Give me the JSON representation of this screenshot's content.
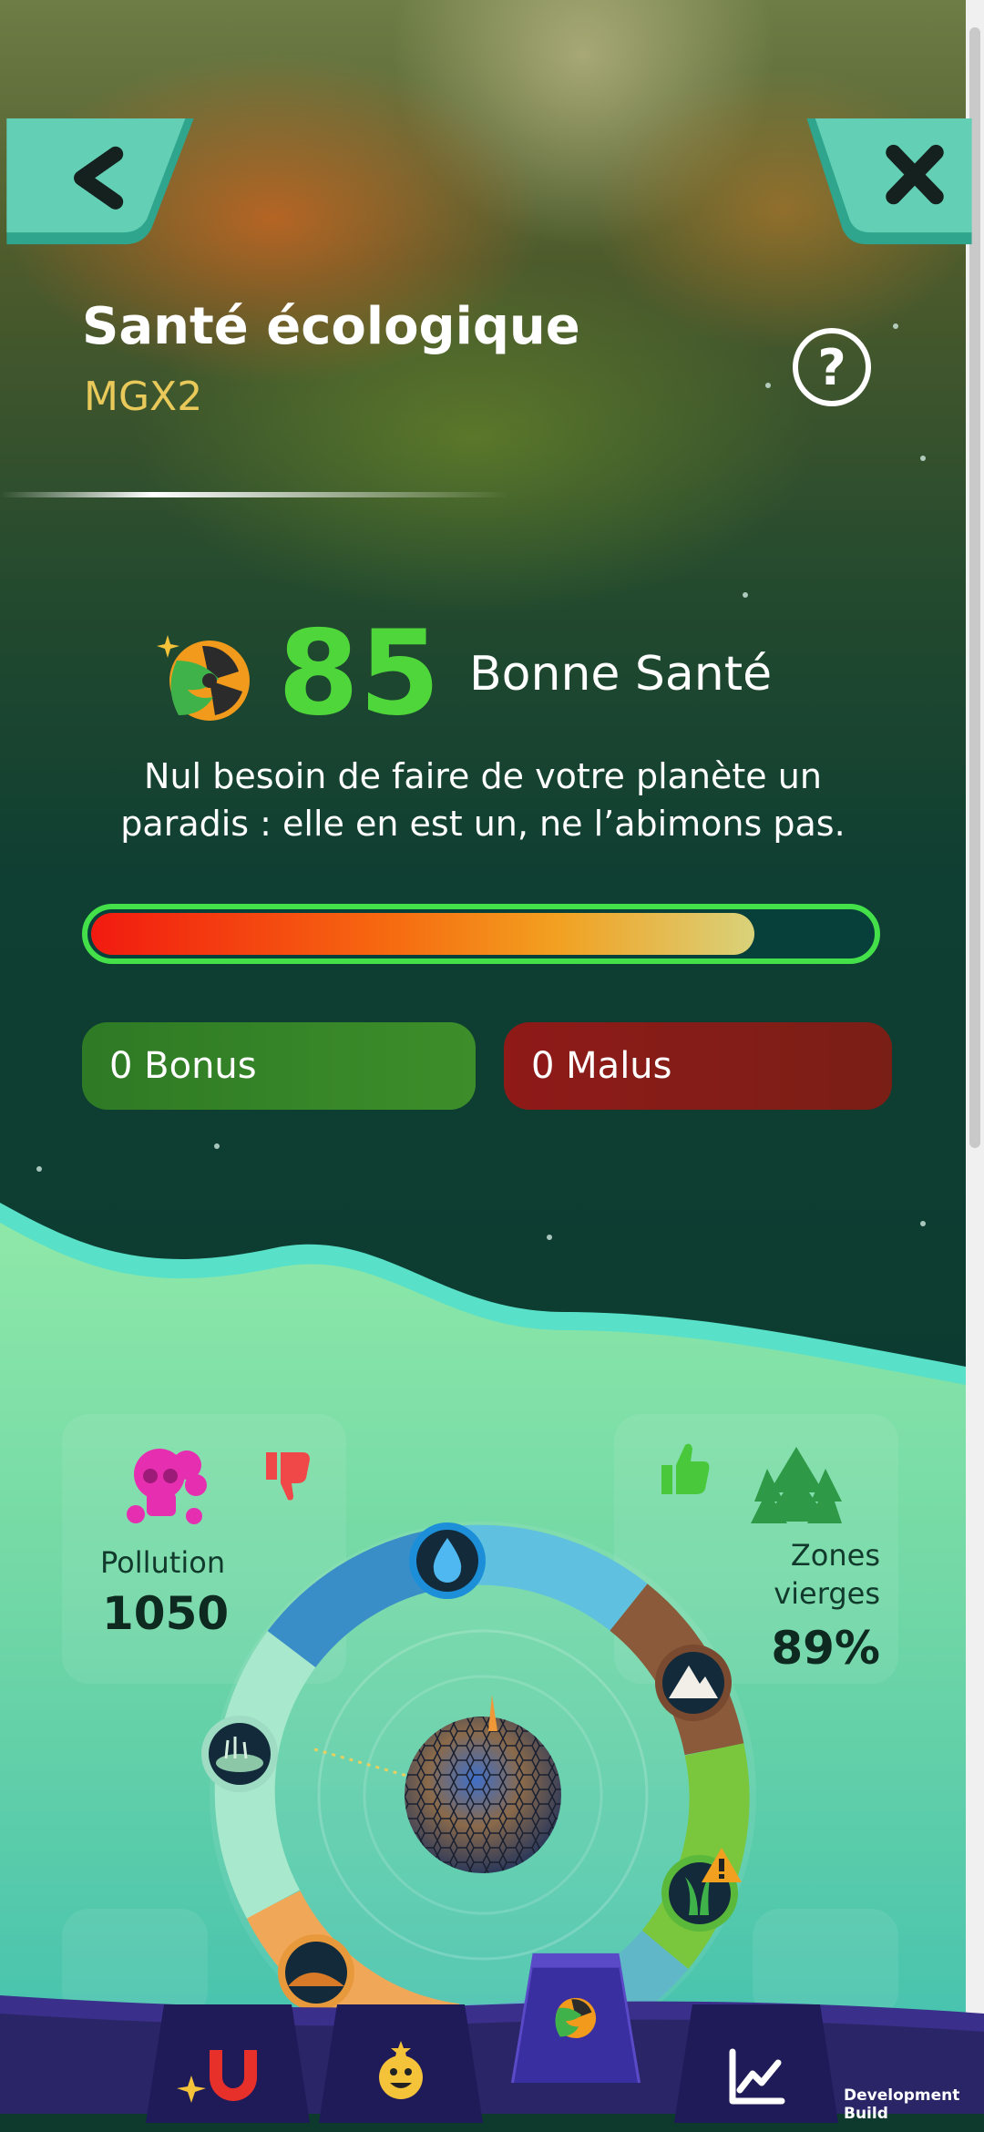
{
  "header": {
    "title": "Santé écologique",
    "subtitle": "MGX2"
  },
  "score": {
    "value": "85",
    "label": "Bonne Santé",
    "description": "Nul besoin de faire de votre planète un paradis : elle en est un, ne l’abimons pas.",
    "health_fraction": 0.85
  },
  "bonus": {
    "label": "0 Bonus"
  },
  "malus": {
    "label": "0 Malus"
  },
  "stats": {
    "pollution": {
      "label": "Pollution",
      "value": "1050"
    },
    "zones": {
      "label": "Zones vierges",
      "value": "89%"
    }
  },
  "ring_icons": [
    "water-drop-icon",
    "mountain-icon",
    "grass-warning-icon",
    "sand-dune-icon",
    "swamp-icon"
  ],
  "tabs": [
    "magnet-tab-icon",
    "smiley-tab-icon",
    "ecology-tab-icon",
    "chart-tab-icon"
  ],
  "footer": {
    "dev_build": "Development Build"
  },
  "colors": {
    "accent_green": "#4fd63a",
    "bonus_bg": "#2e7a25",
    "malus_bg": "#8f1a18",
    "nav_teal": "#63d0b5",
    "subtitle_gold": "#e8c95a"
  }
}
